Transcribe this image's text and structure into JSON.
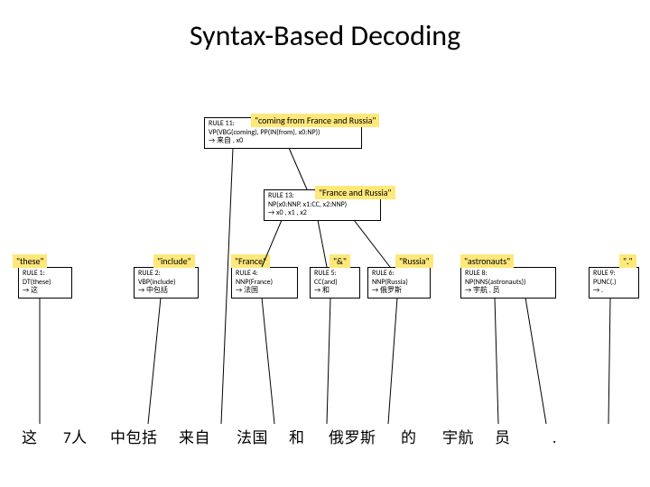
{
  "title": "Syntax-Based Decoding",
  "rule11": {
    "badge": "\"coming from France and Russia\"",
    "l1": "RULE 11:",
    "l2": "VP(VBG(coming), PP(IN(from), x0:NP))",
    "l3": "→ 来自 , x0"
  },
  "rule13": {
    "badge": "\"France and Russia\"",
    "l1": "RULE 13:",
    "l2": "NP(x0:NNP, x1:CC, x2:NNP)",
    "l3": "→ x0 , x1 , x2"
  },
  "rule1": {
    "badge": "\"these\"",
    "l1": "RULE 1:",
    "l2": "DT(these)",
    "l3": "→ 这"
  },
  "rule2": {
    "badge": "\"include\"",
    "l1": "RULE 2:",
    "l2": "VBP(include)",
    "l3": "→ 中包括"
  },
  "rule4": {
    "badge": "\"France\"",
    "l1": "RULE 4:",
    "l2": "NNP(France)",
    "l3": "→ 法国"
  },
  "rule5": {
    "badge": "\"&\"",
    "l1": "RULE 5:",
    "l2": "CC(and)",
    "l3": "→ 和"
  },
  "rule6": {
    "badge": "\"Russia\"",
    "l1": "RULE 6:",
    "l2": "NNP(Russia)",
    "l3": "→ 俄罗斯"
  },
  "rule8": {
    "badge": "\"astronauts\"",
    "l1": "RULE 8:",
    "l2": "NP(NNS(astronauts))",
    "l3": "→ 宇航 , 员"
  },
  "rule9": {
    "badge": "\".\"",
    "l1": "RULE 9:",
    "l2": "PUNC(.)",
    "l3": "→ ."
  },
  "tokens": {
    "t1": "这",
    "t2": "7人",
    "t3": "中包括",
    "t4": "来自",
    "t5": "法国",
    "t6": "和",
    "t7": "俄罗斯",
    "t8": "的",
    "t9": "宇航",
    "t10": "员",
    "t11": "."
  }
}
